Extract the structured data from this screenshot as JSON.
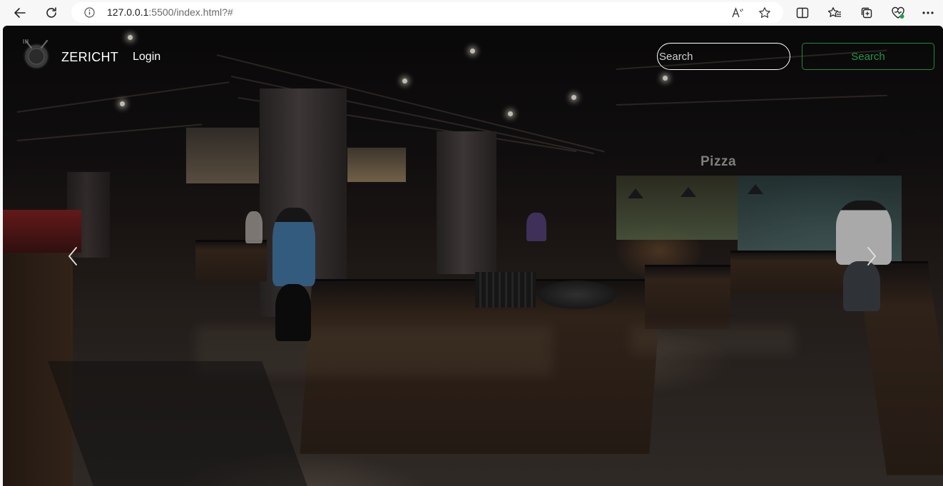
{
  "browser": {
    "url_host": "127.0.0.1",
    "url_rest": ":5500/index.html?#"
  },
  "navbar": {
    "brand": "ZERICHT",
    "login_label": "Login",
    "search_placeholder": "Search",
    "search_button_label": "Search"
  },
  "hero": {
    "sign_text": "Pizza"
  },
  "colors": {
    "accent_green": "#23934a",
    "nav_text": "#ffffff"
  },
  "icons": {
    "back": "back-arrow-icon",
    "refresh": "refresh-icon",
    "info": "info-icon",
    "read_aloud": "read-aloud-icon",
    "favorite": "star-icon",
    "split": "split-screen-icon",
    "favorites": "favorites-icon",
    "collections": "collections-icon",
    "health": "browser-essentials-icon",
    "more": "more-icon",
    "prev": "chevron-left-icon",
    "next": "chevron-right-icon"
  }
}
